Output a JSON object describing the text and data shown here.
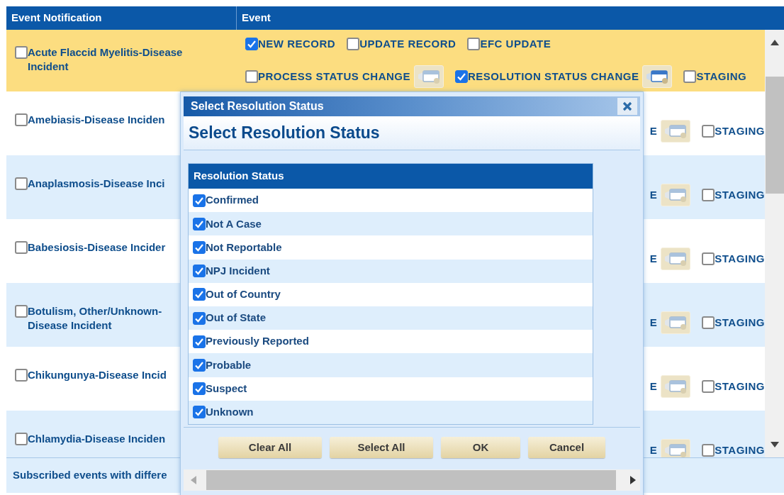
{
  "table": {
    "columns": [
      "Event Notification",
      "Event"
    ],
    "rows": [
      {
        "name_lines": [
          "Acute Flaccid Myelitis-Disease",
          "Incident"
        ],
        "checked": false,
        "selected": true,
        "event_lines": [
          [
            {
              "kind": "checkbox",
              "label": "NEW RECORD",
              "checked": true
            },
            {
              "kind": "checkbox",
              "label": "UPDATE RECORD",
              "checked": false
            },
            {
              "kind": "checkbox",
              "label": "EFC UPDATE",
              "checked": false
            }
          ],
          [
            {
              "kind": "checkbox_picker",
              "label": "PROCESS STATUS CHANGE",
              "checked": false
            },
            {
              "kind": "checkbox_picker",
              "label": "RESOLUTION STATUS CHANGE",
              "checked": true
            },
            {
              "kind": "checkbox",
              "label": "STAGING",
              "checked": false
            }
          ]
        ]
      },
      {
        "name_lines": [
          "Amebiasis-Disease Inciden"
        ],
        "checked": false,
        "selected": false,
        "event_lines": [
          [
            {
              "kind": "picker",
              "label": "E"
            },
            {
              "kind": "checkbox",
              "label": "STAGING",
              "checked": false
            }
          ]
        ]
      },
      {
        "name_lines": [
          "Anaplasmosis-Disease Inci"
        ],
        "checked": false,
        "selected": false,
        "event_lines": [
          [
            {
              "kind": "picker",
              "label": "E"
            },
            {
              "kind": "checkbox",
              "label": "STAGING",
              "checked": false
            }
          ]
        ]
      },
      {
        "name_lines": [
          "Babesiosis-Disease Incider"
        ],
        "checked": false,
        "selected": false,
        "event_lines": [
          [
            {
              "kind": "picker",
              "label": "E"
            },
            {
              "kind": "checkbox",
              "label": "STAGING",
              "checked": false
            }
          ]
        ]
      },
      {
        "name_lines": [
          "Botulism, Other/Unknown-",
          "Disease Incident"
        ],
        "checked": false,
        "selected": false,
        "event_lines": [
          [
            {
              "kind": "picker",
              "label": "E"
            },
            {
              "kind": "checkbox",
              "label": "STAGING",
              "checked": false
            }
          ]
        ]
      },
      {
        "name_lines": [
          "Chikungunya-Disease Incid"
        ],
        "checked": false,
        "selected": false,
        "event_lines": [
          [
            {
              "kind": "picker",
              "label": "E"
            },
            {
              "kind": "checkbox",
              "label": "STAGING",
              "checked": false
            }
          ]
        ]
      },
      {
        "name_lines": [
          "Chlamydia-Disease Inciden"
        ],
        "checked": false,
        "selected": false,
        "event_lines": [
          [
            {
              "kind": "picker",
              "label": "E"
            },
            {
              "kind": "checkbox",
              "label": "STAGING",
              "checked": false
            }
          ]
        ]
      }
    ]
  },
  "footer_note": "Subscribed events with differe",
  "dialog": {
    "title": "Select Resolution Status",
    "heading": "Select Resolution Status",
    "column": "Resolution Status",
    "statuses": [
      {
        "label": "Confirmed",
        "checked": true
      },
      {
        "label": "Not A Case",
        "checked": true
      },
      {
        "label": "Not Reportable",
        "checked": true
      },
      {
        "label": "NPJ Incident",
        "checked": true
      },
      {
        "label": "Out of Country",
        "checked": true
      },
      {
        "label": "Out of State",
        "checked": true
      },
      {
        "label": "Previously Reported",
        "checked": true
      },
      {
        "label": "Probable",
        "checked": true
      },
      {
        "label": "Suspect",
        "checked": true
      },
      {
        "label": "Unknown",
        "checked": true
      }
    ],
    "buttons": [
      "Clear All",
      "Select All",
      "OK",
      "Cancel"
    ]
  }
}
